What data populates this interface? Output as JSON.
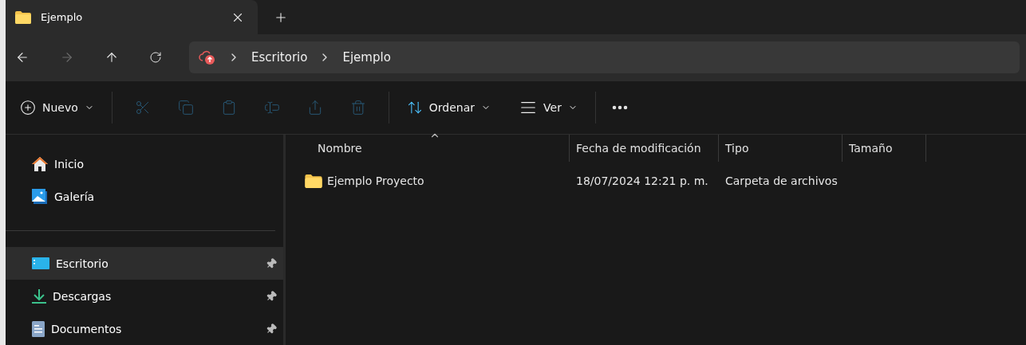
{
  "tab": {
    "title": "Ejemplo"
  },
  "nav": {
    "back_disabled": false,
    "forward_disabled": true
  },
  "breadcrumb": [
    "Escritorio",
    "Ejemplo"
  ],
  "toolbar": {
    "new_label": "Nuevo",
    "actions": [
      {
        "kind": "cut",
        "disabled": true
      },
      {
        "kind": "copy",
        "disabled": true
      },
      {
        "kind": "paste",
        "disabled": true
      },
      {
        "kind": "rename",
        "disabled": true
      },
      {
        "kind": "share",
        "disabled": true
      },
      {
        "kind": "delete",
        "disabled": true
      }
    ],
    "sort_label": "Ordenar",
    "view_label": "Ver"
  },
  "sidebar": {
    "groups": [
      [
        {
          "kind": "home",
          "label": "Inicio",
          "selected": false,
          "pinned": false
        },
        {
          "kind": "gallery",
          "label": "Galería",
          "selected": false,
          "pinned": false
        }
      ],
      [
        {
          "kind": "desktop",
          "label": "Escritorio",
          "selected": true,
          "pinned": true
        },
        {
          "kind": "downloads",
          "label": "Descargas",
          "selected": false,
          "pinned": true
        },
        {
          "kind": "documents",
          "label": "Documentos",
          "selected": false,
          "pinned": true
        }
      ]
    ]
  },
  "table": {
    "columns": [
      {
        "label": "Nombre",
        "sorted": true
      },
      {
        "label": "Fecha de modificación",
        "sorted": false
      },
      {
        "label": "Tipo",
        "sorted": false
      },
      {
        "label": "Tamaño",
        "sorted": false
      }
    ],
    "rows": [
      {
        "kind": "folder",
        "cells": [
          "Ejemplo Proyecto",
          "18/07/2024 12:21 p. m.",
          "Carpeta de archivos",
          ""
        ]
      }
    ]
  }
}
